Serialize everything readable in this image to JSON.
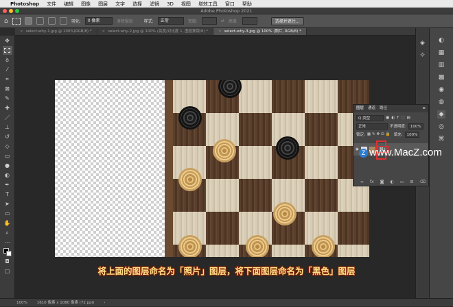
{
  "menubar": {
    "apple": "",
    "app": "Photoshop",
    "items": [
      "文件",
      "编辑",
      "图像",
      "图层",
      "文字",
      "选择",
      "滤镜",
      "3D",
      "视图",
      "增效工具",
      "窗口",
      "帮助"
    ]
  },
  "titlebar": {
    "title": "Adobe Photoshop 2021"
  },
  "optionsbar": {
    "feather_label": "羽化:",
    "feather_value": "0 像素",
    "antialias_label": "消除锯齿",
    "style_label": "样式:",
    "style_value": "正常",
    "width_label": "宽度:",
    "height_label": "高度:",
    "select_mask_button": "选择并遮住..."
  },
  "tabs": [
    {
      "label": "select-why-1.jpg @ 100%(RGB/8) *",
      "active": false
    },
    {
      "label": "select-why-2.jpg @ 100% (亮度/对比度 1, 图层蒙版/8) *",
      "active": false
    },
    {
      "label": "select-why-3.jpg @ 100% (照片, RGB/8) *",
      "active": true
    }
  ],
  "tools": [
    "move-icon",
    "marquee-icon",
    "lasso-icon",
    "quick-select-icon",
    "crop-icon",
    "frame-icon",
    "eyedropper-icon",
    "healing-icon",
    "brush-icon",
    "stamp-icon",
    "history-brush-icon",
    "eraser-icon",
    "gradient-icon",
    "blur-icon",
    "dodge-icon",
    "pen-icon",
    "type-icon",
    "path-select-icon",
    "rectangle-icon",
    "hand-icon",
    "zoom-icon",
    "more-icon",
    "colors-icon",
    "quickmask-icon",
    "screenmode-icon"
  ],
  "layers_panel": {
    "tabs": [
      "图层",
      "通道",
      "路径"
    ],
    "kind_label": "Q 类型",
    "blend_mode": "正常",
    "opacity_label": "不透明度:",
    "opacity_value": "100%",
    "lock_label": "锁定:",
    "fill_label": "填充:",
    "fill_value": "100%",
    "layer_name": "照片"
  },
  "watermark": {
    "logo": "Z",
    "text": "www.MacZ.com"
  },
  "caption": "将上面的图层命名为「照片」图层，将下面图层命名为「黑色」图层",
  "status": {
    "zoom": "100%",
    "doc_info": "1616 像素 x 1080 像素 (72 ppi)",
    "arrow": "›"
  }
}
